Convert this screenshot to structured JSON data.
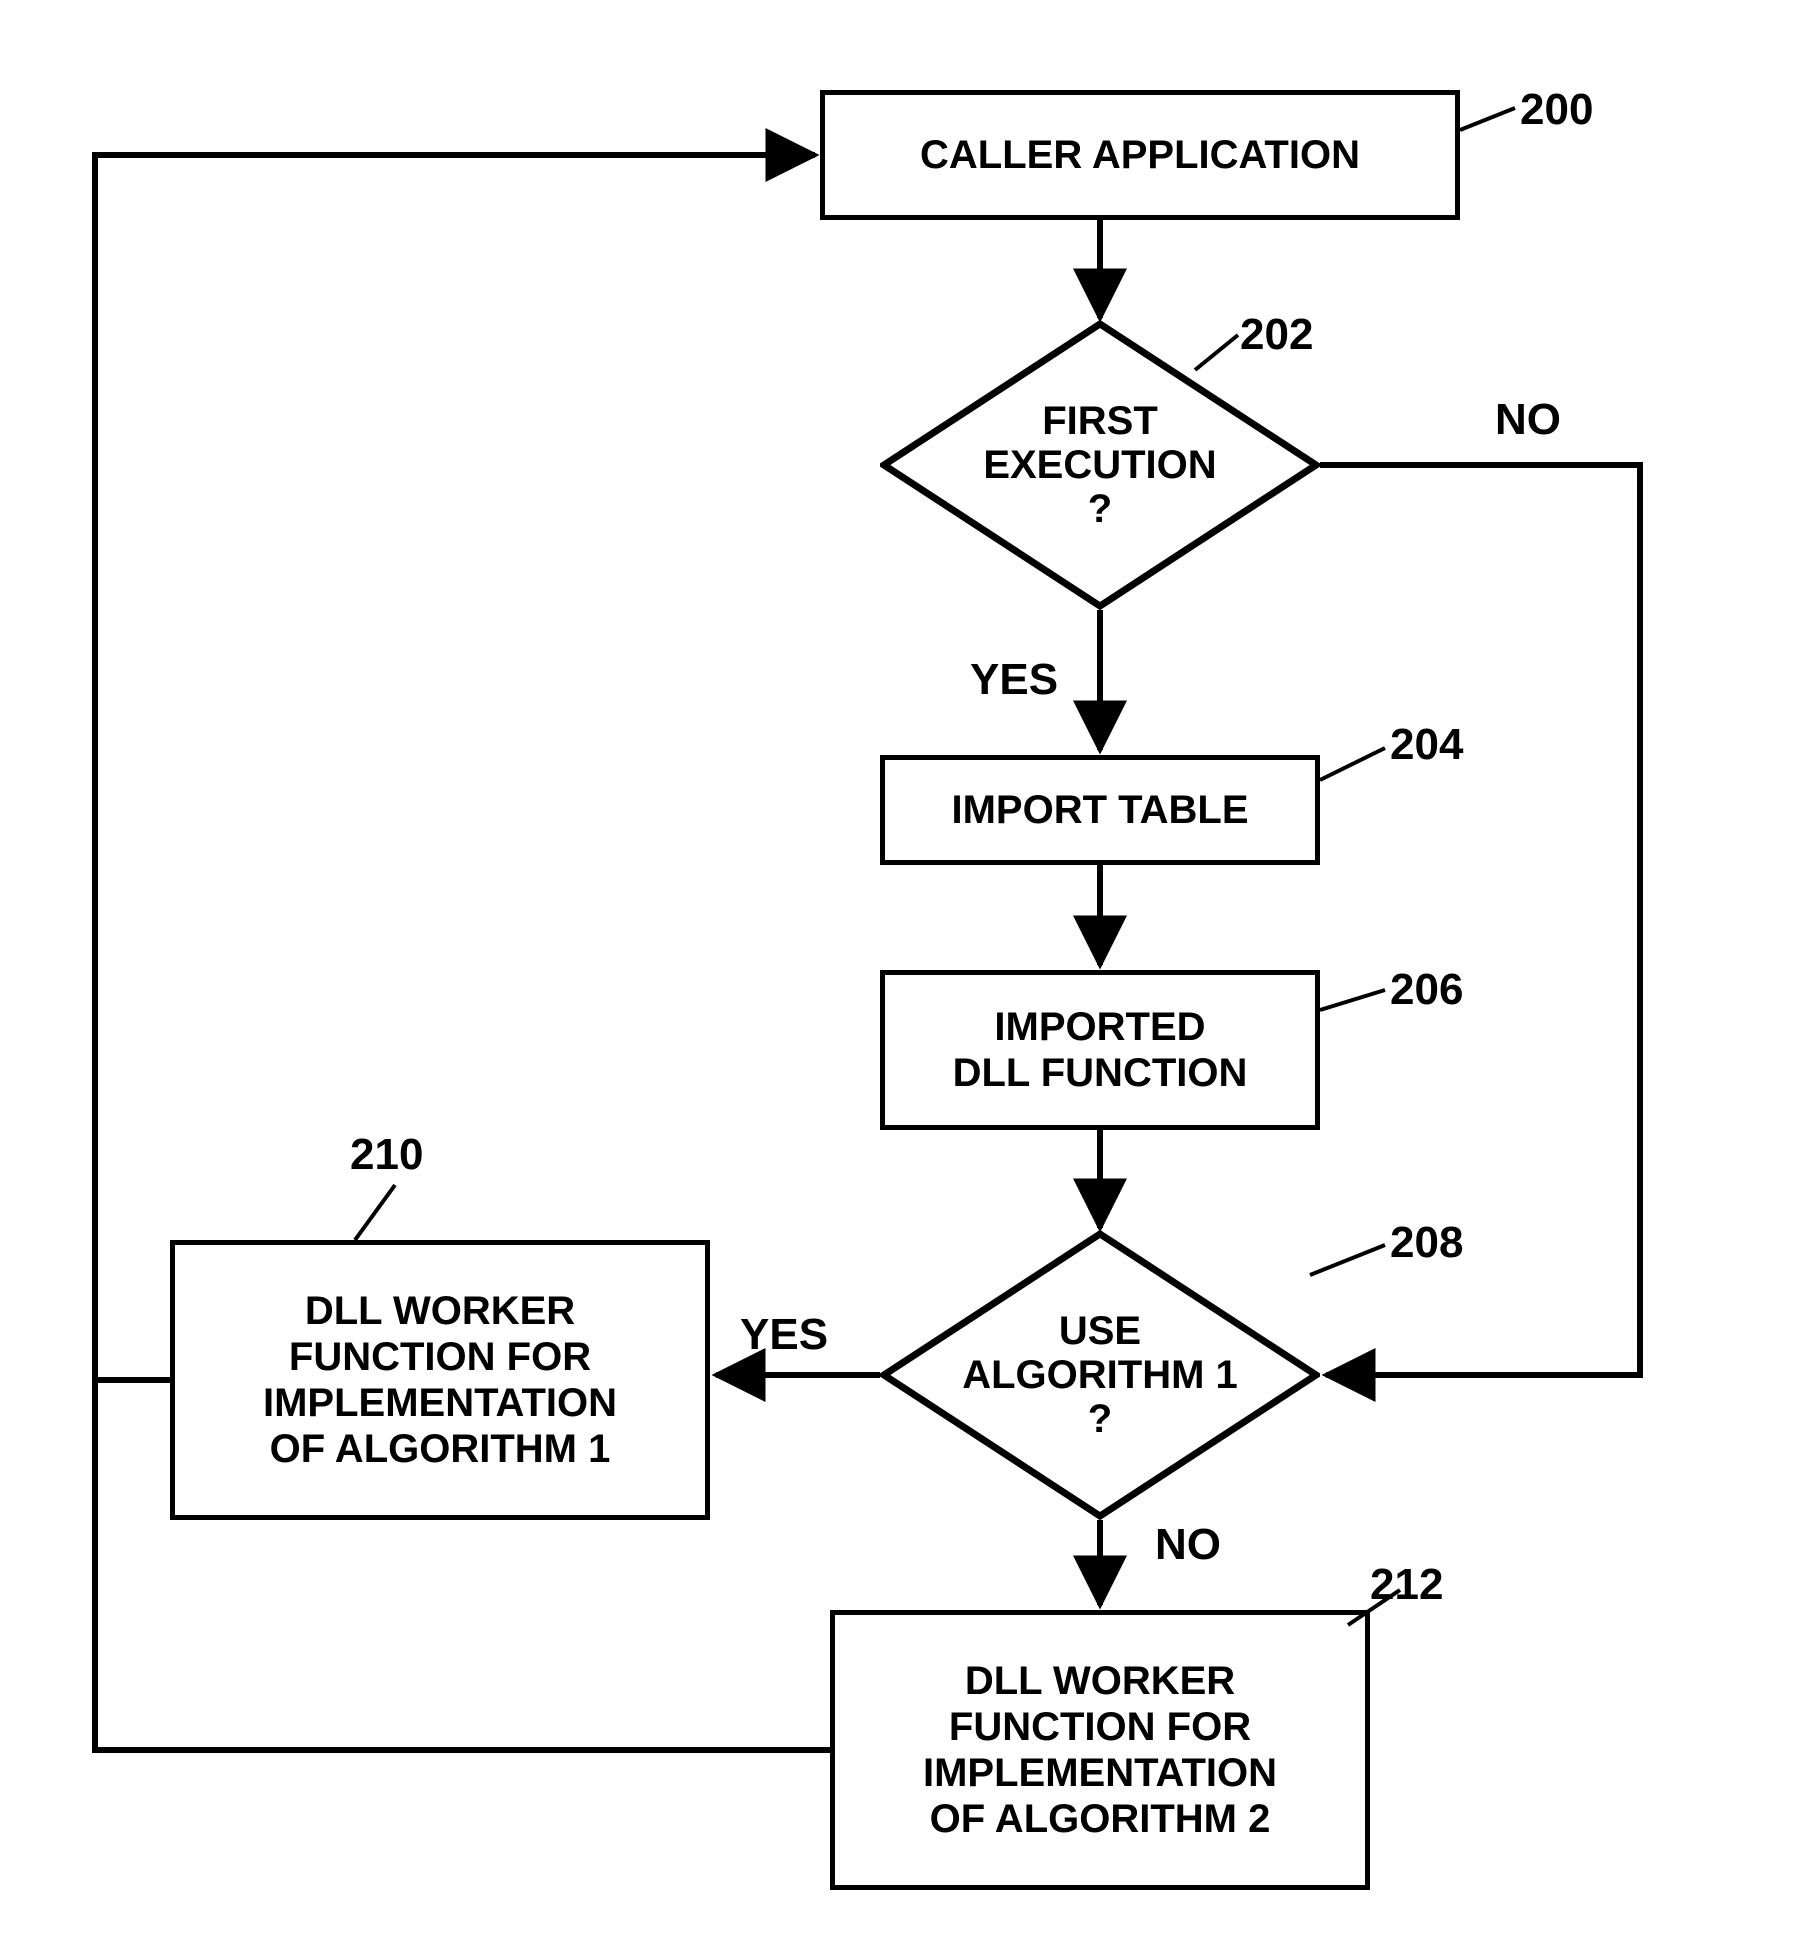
{
  "nodes": {
    "n200": {
      "text": "CALLER APPLICATION",
      "ref": "200"
    },
    "n202": {
      "text": "FIRST\nEXECUTION\n?",
      "ref": "202"
    },
    "n204": {
      "text": "IMPORT TABLE",
      "ref": "204"
    },
    "n206": {
      "text": "IMPORTED\nDLL FUNCTION",
      "ref": "206"
    },
    "n208": {
      "text": "USE\nALGORITHM 1\n?",
      "ref": "208"
    },
    "n210": {
      "text": "DLL WORKER\nFUNCTION FOR\nIMPLEMENTATION\nOF ALGORITHM 1",
      "ref": "210"
    },
    "n212": {
      "text": "DLL WORKER\nFUNCTION FOR\nIMPLEMENTATION\nOF ALGORITHM 2",
      "ref": "212"
    }
  },
  "edge_labels": {
    "d202_yes": "YES",
    "d202_no": "NO",
    "d208_yes": "YES",
    "d208_no": "NO"
  },
  "chart_data": {
    "type": "flowchart",
    "nodes": [
      {
        "id": "200",
        "shape": "rect",
        "label": "CALLER APPLICATION"
      },
      {
        "id": "202",
        "shape": "diamond",
        "label": "FIRST EXECUTION ?"
      },
      {
        "id": "204",
        "shape": "rect",
        "label": "IMPORT TABLE"
      },
      {
        "id": "206",
        "shape": "rect",
        "label": "IMPORTED DLL FUNCTION"
      },
      {
        "id": "208",
        "shape": "diamond",
        "label": "USE ALGORITHM 1 ?"
      },
      {
        "id": "210",
        "shape": "rect",
        "label": "DLL WORKER FUNCTION FOR IMPLEMENTATION OF ALGORITHM 1"
      },
      {
        "id": "212",
        "shape": "rect",
        "label": "DLL WORKER FUNCTION FOR IMPLEMENTATION OF ALGORITHM 2"
      }
    ],
    "edges": [
      {
        "from": "200",
        "to": "202",
        "label": ""
      },
      {
        "from": "202",
        "to": "204",
        "label": "YES"
      },
      {
        "from": "202",
        "to": "208",
        "label": "NO"
      },
      {
        "from": "204",
        "to": "206",
        "label": ""
      },
      {
        "from": "206",
        "to": "208",
        "label": ""
      },
      {
        "from": "208",
        "to": "210",
        "label": "YES"
      },
      {
        "from": "208",
        "to": "212",
        "label": "NO"
      },
      {
        "from": "210",
        "to": "200",
        "label": ""
      },
      {
        "from": "212",
        "to": "200",
        "label": ""
      }
    ]
  }
}
